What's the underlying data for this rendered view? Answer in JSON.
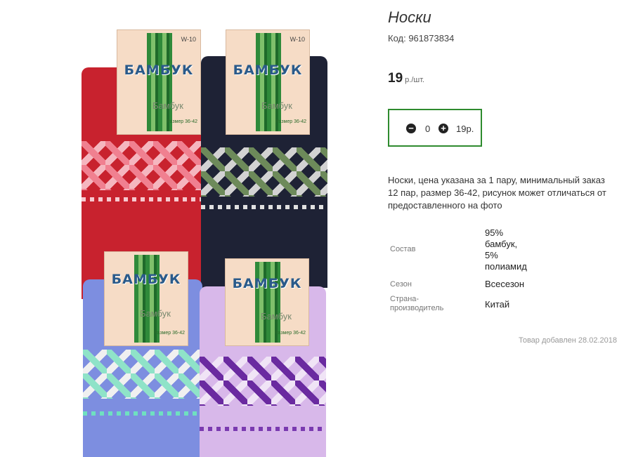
{
  "product": {
    "title": "Носки",
    "code_label": "Код: 961873834",
    "price_value": "19",
    "price_unit": "р./шт.",
    "quantity": "0",
    "sum": "19р.",
    "description": "Носки, цена указана за 1 пару, минимальный заказ 12 пар, размер 36-42, рисунок может отличаться от предоставленного на фото",
    "specs": [
      {
        "label": "Состав",
        "value": "95%\nбамбук,\n5%\nполиамид"
      },
      {
        "label": "Сезон",
        "value": "Всесезон"
      },
      {
        "label": "Страна-\nпроизводитель",
        "value": "Китай"
      }
    ],
    "added": "Товар добавлен 28.02.2018"
  },
  "photo": {
    "tag_brand": "БАМБУК",
    "tag_brand_small": "Бамбук",
    "tag_code": "W-10",
    "tag_size": "Размер 36-42",
    "colors": {
      "red": "#c8222e",
      "navy": "#1e2235",
      "blue": "#7d8ee0",
      "lilac": "#d8b8ea",
      "accent_green": "#2e8b2e"
    }
  }
}
